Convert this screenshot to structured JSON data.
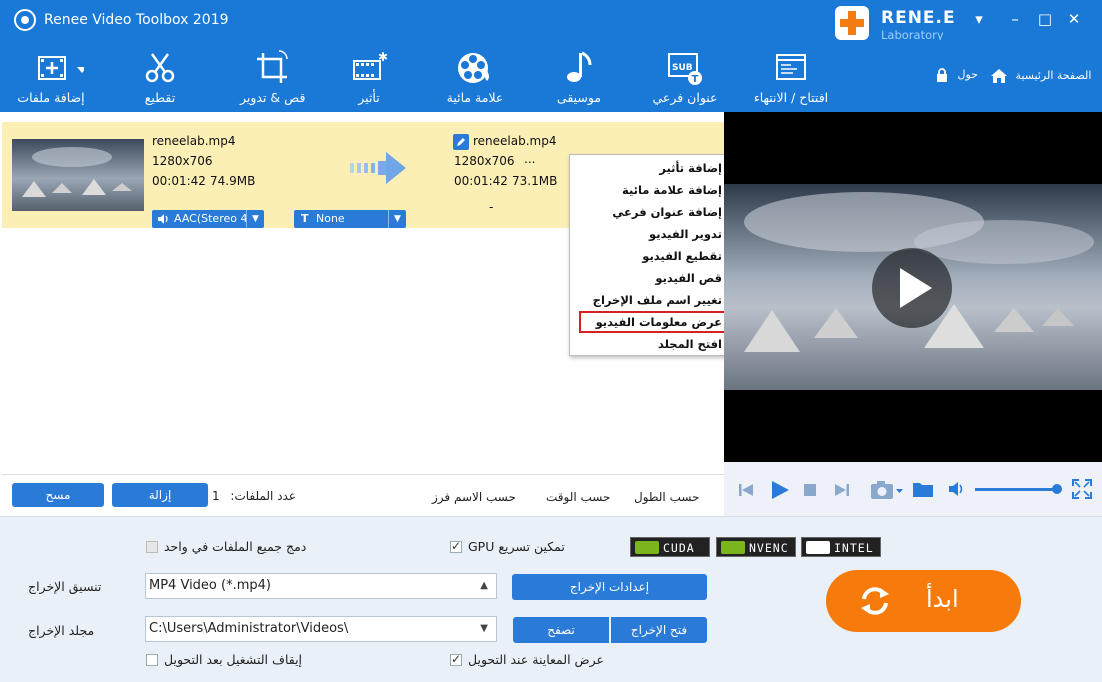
{
  "window": {
    "title": "Renee Video Toolbox 2019",
    "min": "–",
    "max": "□",
    "close": "✕",
    "menu": "▾"
  },
  "logo": {
    "brand": "RENE.E",
    "sub": "Laboratory"
  },
  "toolbar": {
    "add_files": "إضافة ملفات",
    "cut": "تقطيع",
    "crop_rotate": "قص & تدوير",
    "effect": "تأثير",
    "watermark": "علامة مائية",
    "music": "موسيقى",
    "subtitle": "عنوان فرعي",
    "open_close": "افتتاح / الانتهاء",
    "about": "حول",
    "home": "الصفحة الرئيسية"
  },
  "file_row": {
    "src_name": "reneelab.mp4",
    "src_res": "1280x706",
    "src_time": "00:01:42",
    "src_size": "74.9MB",
    "dst_name": "reneelab.mp4",
    "dst_res": "1280x706",
    "dst_more": "...",
    "dst_time": "00:01:42",
    "dst_size": "73.1MB",
    "audio": "AAC(Stereo 4",
    "subtitle": "None",
    "dash": "-"
  },
  "context_menu": {
    "items": [
      "إضافة تأثير",
      "إضافة علامة مائية",
      "إضافة عنوان فرعي",
      "تدوير الفيديو",
      "تقطيع الفيديو",
      "قص الفيديو",
      "تغيير اسم ملف الإخراج",
      "عرض معلومات الفيديو",
      "افتح المجلد"
    ],
    "highlighted_index": 7
  },
  "list_bar": {
    "clear": "مسح",
    "remove": "إزالة",
    "file_count_label": "عدد الملفات:",
    "file_count": "1",
    "sort_length": "حسب الطول",
    "sort_time": "حسب الوقت",
    "sort_name": "حسب الاسم فرز"
  },
  "settings": {
    "merge_label": "دمج جميع الملفات في واحد",
    "merge_checked": false,
    "gpu_label": "تمكين تسريع GPU",
    "gpu_checked": true,
    "badges": [
      "CUDA",
      "NVENC",
      "INTEL"
    ],
    "format_label": "تنسيق الإخراج",
    "format_value": "MP4 Video (*.mp4)",
    "output_settings": "إعدادات الإخراج",
    "folder_label": "مجلد الإخراج",
    "folder_value": "C:\\Users\\Administrator\\Videos\\",
    "browse": "تصفح",
    "open_output": "فتح الإخراج",
    "stop_label": "إيقاف التشغيل بعد التحويل",
    "stop_checked": false,
    "preview_label": "عرض المعاينة عند التحويل",
    "preview_checked": true,
    "start": "ابدأ"
  },
  "colors": {
    "titlebar": "#1a78d6",
    "accent": "#2a7ad7",
    "start": "#f77b0b",
    "row": "#fcefb5",
    "highlight_border": "#d32222"
  }
}
